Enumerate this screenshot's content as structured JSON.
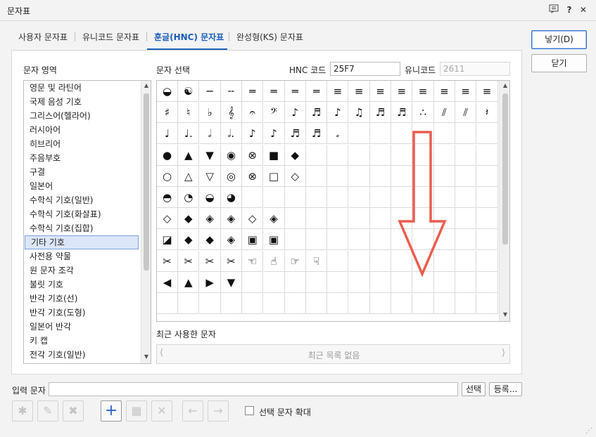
{
  "window": {
    "title": "문자표",
    "help_icon": "?",
    "close_icon": "✕"
  },
  "tabs": [
    {
      "label": "사용자 문자표",
      "active": false
    },
    {
      "label": "유니코드 문자표",
      "active": false
    },
    {
      "label": "훈글(HNC) 문자표",
      "active": true
    },
    {
      "label": "완성형(KS) 문자표",
      "active": false
    }
  ],
  "buttons": {
    "insert": "넣기(D)",
    "close": "닫기"
  },
  "area": {
    "label": "문자 영역",
    "items": [
      "영문 및 라틴어",
      "국제 음성 기호",
      "그리스어(헬라어)",
      "러시아어",
      "히브리어",
      "주음부호",
      "구결",
      "일본어",
      "수학식 기호(일반)",
      "수학식 기호(화살표)",
      "수학식 기호(집합)",
      "기타 기호",
      "사전용 약물",
      "원 문자 조각",
      "불릿 기호",
      "반각 기호(선)",
      "반각 기호(도형)",
      "일본어 반각",
      "키 캡",
      "전각 기호(일반)"
    ],
    "selected_index": 11
  },
  "selection": {
    "label": "문자 선택",
    "hnc_label": "HNC 코드",
    "hnc_value": "25F7",
    "unicode_label": "유니코드",
    "unicode_value": "2611"
  },
  "grid": {
    "rows": [
      [
        "◒",
        "☯",
        "─",
        "╌",
        "═",
        "═",
        "═",
        "═",
        "≡",
        "≡",
        "≡",
        "≡",
        "≡",
        "≡",
        "≡",
        "≡"
      ],
      [
        "♯",
        "♮",
        "♭",
        "𝄞",
        "𝄐",
        "𝄢",
        "♪",
        "♬",
        "♪",
        "♫",
        "♬",
        "♬",
        "∴",
        "⫽",
        "⫽",
        "𝄽"
      ],
      [
        "♩",
        "♩.",
        "𝅗𝅥",
        "𝅗𝅥.",
        "♪",
        "♪",
        "♬",
        "♬",
        "𝅗",
        "",
        "",
        "",
        "",
        "",
        "",
        ""
      ],
      [
        "●",
        "▲",
        "▼",
        "◉",
        "⊗",
        "■",
        "◆",
        "",
        "",
        "",
        "",
        "",
        "",
        "",
        "",
        ""
      ],
      [
        "○",
        "△",
        "▽",
        "◎",
        "⊗",
        "□",
        "◇",
        "",
        "",
        "",
        "",
        "",
        "",
        "",
        "",
        ""
      ],
      [
        "◓",
        "◔",
        "◒",
        "◕",
        "",
        "",
        "",
        "",
        "",
        "",
        "",
        "",
        "",
        "",
        "",
        ""
      ],
      [
        "◇",
        "◆",
        "◈",
        "◈",
        "◇",
        "◈",
        "",
        "",
        "",
        "",
        "",
        "",
        "",
        "",
        "",
        ""
      ],
      [
        "◪",
        "◆",
        "◆",
        "◈",
        "▣",
        "▣",
        "",
        "",
        "",
        "",
        "",
        "",
        "",
        "",
        "",
        ""
      ],
      [
        "✂",
        "✂",
        "✂",
        "✂",
        "☜",
        "☝",
        "☞",
        "☟",
        "",
        "",
        "",
        "",
        "",
        "",
        "",
        ""
      ],
      [
        "◀",
        "▲",
        "▶",
        "▼",
        "",
        "",
        "",
        "",
        "",
        "",
        "",
        "",
        "",
        "",
        "",
        ""
      ],
      [
        "",
        "",
        "",
        "",
        "",
        "",
        "",
        "",
        "",
        "",
        "",
        "",
        "",
        "",
        "",
        ""
      ]
    ]
  },
  "recent": {
    "label": "최근 사용한 문자",
    "empty_text": "최근 목록 없음"
  },
  "input": {
    "label": "입력 문자",
    "value": "",
    "select_button": "선택",
    "register_button": "등록..."
  },
  "enlarge_checkbox": {
    "label": "선택 문자 확대",
    "checked": false
  }
}
